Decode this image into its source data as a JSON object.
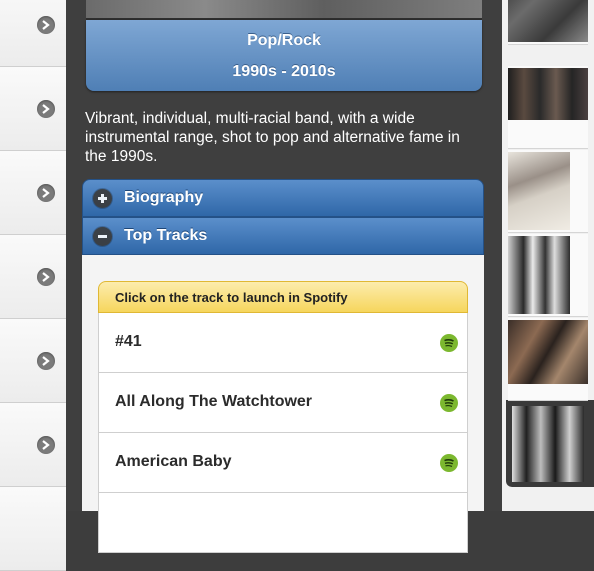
{
  "genre": {
    "name": "Pop/Rock",
    "years": "1990s - 2010s"
  },
  "description": "Vibrant, individual, multi-racial band, with a wide instrumental range, shot to pop and alternative fame in the 1990s.",
  "sections": {
    "biography": "Biography",
    "top_tracks": "Top Tracks"
  },
  "tracks_notice": "Click on the track to launch in Spotify",
  "tracks": [
    "#41",
    "All Along The Watchtower",
    "American Baby",
    ""
  ],
  "left_rows": 6,
  "thumbnails": [
    "artist-photo-1",
    "artist-photo-2",
    "artist-photo-3",
    "artist-photo-4",
    "artist-photo-5",
    "artist-photo-6"
  ],
  "colors": {
    "header_blue": "#2f67a8",
    "notice_yellow": "#f6d65d",
    "spotify_green": "#7cb82f"
  }
}
